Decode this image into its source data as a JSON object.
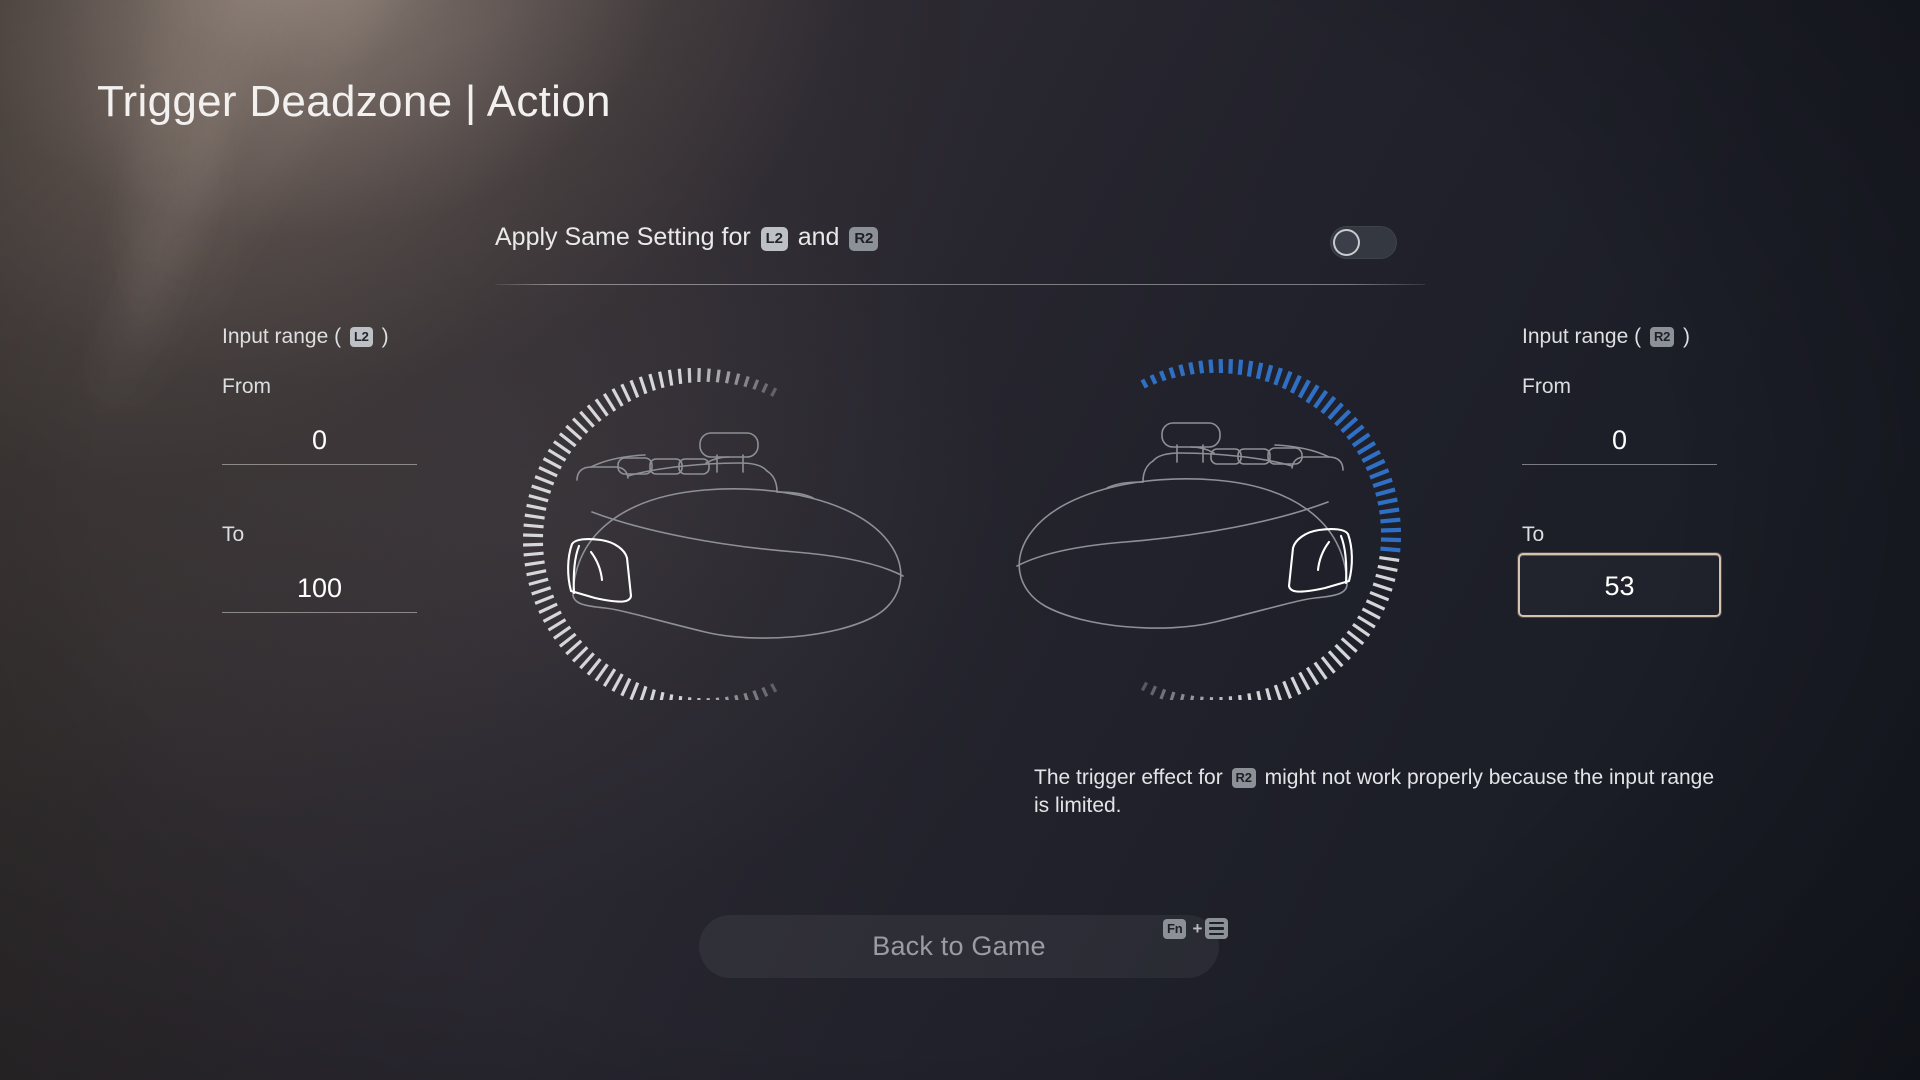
{
  "page_title": "Trigger Deadzone | Action",
  "apply_same": {
    "label_prefix": "Apply Same Setting for",
    "key_left": "L2",
    "label_middle": "and",
    "key_right": "R2",
    "toggle_state": "off",
    "toggle_name": "apply-same-setting-toggle"
  },
  "left_range": {
    "heading_prefix": "Input range (",
    "key": "L2",
    "heading_suffix": ")",
    "from_label": "From",
    "from_value": "0",
    "to_label": "To",
    "to_value": "100",
    "focused_field": "none"
  },
  "right_range": {
    "heading_prefix": "Input range (",
    "key": "R2",
    "heading_suffix": ")",
    "from_label": "From",
    "from_value": "0",
    "to_label": "To",
    "to_value": "53",
    "focused_field": "to"
  },
  "warning": {
    "text_before": "The trigger effect for",
    "key": "R2",
    "text_after": "might not work properly because the input range is limited."
  },
  "footer": {
    "back_label": "Back to Game",
    "hint_key": "Fn",
    "hint_plus": "+",
    "hint_icon": "menu-icon"
  },
  "colors": {
    "accent_blue": "#2f6fc4",
    "focus_border": "#d6c3ae",
    "tick_inactive": "#e8e9ec",
    "tick_dim": "#6f737d",
    "keycap_bg": "#bdc0c4",
    "background_dark": "#1a1d26",
    "background_warm": "#3a3431"
  },
  "chart_data": {
    "type": "gauge",
    "title": "Trigger input range dials",
    "dials": [
      {
        "name": "L2",
        "from": 0,
        "to": 100,
        "min": 0,
        "max": 100,
        "active_ticks": 0,
        "total_ticks": 72,
        "active_color": "#2f6fc4",
        "inactive_color": "#e8e9ec"
      },
      {
        "name": "R2",
        "from": 0,
        "to": 53,
        "min": 0,
        "max": 100,
        "active_ticks": 38,
        "total_ticks": 72,
        "active_color": "#2f6fc4",
        "inactive_color": "#e8e9ec"
      }
    ]
  }
}
